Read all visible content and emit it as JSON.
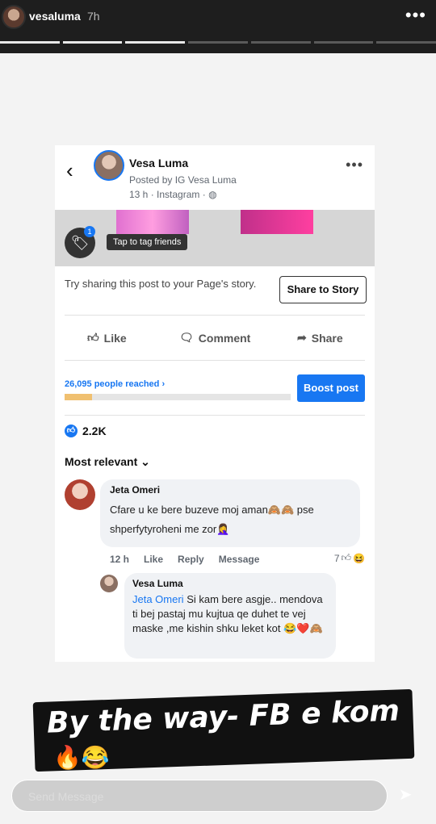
{
  "story": {
    "username": "vesaluma",
    "time": "7h",
    "more_label": "•••"
  },
  "post": {
    "page_name": "Vesa Luma",
    "posted_by": "Posted by IG Vesa Luma",
    "meta": "13 h · Instagram ·",
    "tag_tooltip": "Tap to tag friends",
    "tag_badge": "1",
    "share_prompt": "Try sharing this post to your Page's story.",
    "share_button": "Share to Story",
    "actions": [
      "Like",
      "Comment",
      "Share"
    ],
    "reached": "26,095 people reached",
    "reached_fraction": 0.12,
    "boost": "Boost post",
    "like_count": "2.2K",
    "sort_label": "Most relevant"
  },
  "comments": [
    {
      "author": "Jeta Omeri",
      "text": "Cfare u ke bere buzeve moj aman🙈🙈 pse shperfytyroheni me zor🤦‍♀️",
      "time": "12 h",
      "actions": [
        "Like",
        "Reply",
        "Message"
      ],
      "reactions": "7"
    },
    {
      "author": "Vesa Luma",
      "mention": "Jeta Omeri",
      "text": "Si kam bere asgje.. mendova ti bej pastaj mu kujtua qe duhet te vej maske ,me kishin shku leket kot 😂❤️🙈"
    }
  ],
  "overlay": {
    "caption": "By the way- FB e kom",
    "emojis": "🔥😂"
  },
  "send": {
    "placeholder": "Send Message"
  }
}
